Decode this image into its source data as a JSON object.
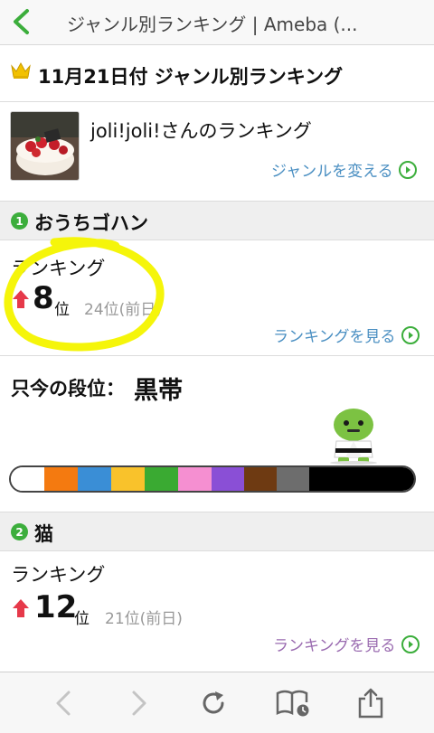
{
  "nav": {
    "title": "ジャンル別ランキング | Ameba (..."
  },
  "header": {
    "title": "11月21日付 ジャンル別ランキング"
  },
  "user": {
    "name": "joli!joli!さんのランキング",
    "change_genre": "ジャンルを変える"
  },
  "genres": [
    {
      "number": "1",
      "name": "おうちゴハン",
      "ranking_label": "ランキング",
      "rank": "8",
      "rank_unit": "位",
      "previous": "24位(前日)",
      "view_link": "ランキングを見る",
      "trend": "up"
    },
    {
      "number": "2",
      "name": "猫",
      "ranking_label": "ランキング",
      "rank": "12",
      "rank_unit": "位",
      "previous": "21位(前日)",
      "view_link": "ランキングを見る",
      "trend": "up"
    }
  ],
  "dan": {
    "label": "只今の段位：",
    "value": "黒帯",
    "belt_colors": [
      "#ffffff",
      "#f47a10",
      "#3a8ed6",
      "#f9c22b",
      "#3aaa32",
      "#f58fd1",
      "#8a4fd6",
      "#6e3a12",
      "#6d6d6d",
      "#000000"
    ]
  },
  "colors": {
    "accent_green": "#3cae3c",
    "link_blue": "#4a8fc2",
    "link_purple": "#9a6bb0",
    "highlight": "#f5f50a",
    "arrow_red": "#e6394a"
  },
  "icons": [
    "chevron-left-icon",
    "crown-icon",
    "circle-arrow-right-icon",
    "up-arrow-icon",
    "mascot-icon",
    "back-icon",
    "forward-icon",
    "reload-icon",
    "bookmarks-icon",
    "share-icon"
  ]
}
